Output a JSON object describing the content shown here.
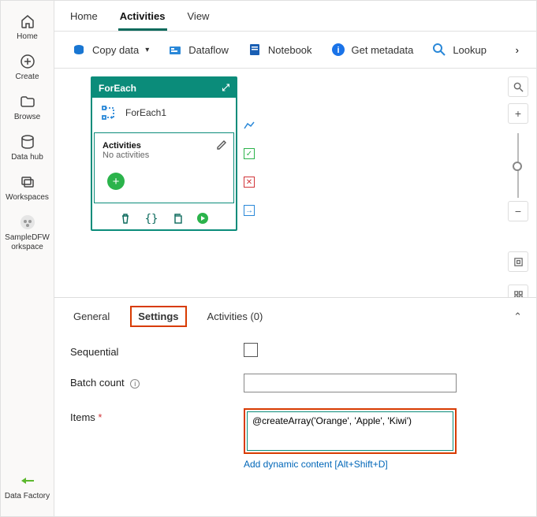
{
  "rail": {
    "items": [
      {
        "label": "Home"
      },
      {
        "label": "Create"
      },
      {
        "label": "Browse"
      },
      {
        "label": "Data hub"
      },
      {
        "label": "Workspaces"
      },
      {
        "label": "SampleDFW orkspace"
      }
    ],
    "bottom": {
      "label": "Data Factory"
    }
  },
  "tabs": [
    {
      "label": "Home"
    },
    {
      "label": "Activities"
    },
    {
      "label": "View"
    }
  ],
  "toolbar": {
    "copy_data": "Copy data",
    "dataflow": "Dataflow",
    "notebook": "Notebook",
    "get_metadata": "Get metadata",
    "lookup": "Lookup"
  },
  "node": {
    "title": "ForEach",
    "name": "ForEach1",
    "section_title": "Activities",
    "section_sub": "No activities"
  },
  "detail": {
    "tabs": {
      "general": "General",
      "settings": "Settings",
      "activities": "Activities (0)"
    },
    "form": {
      "sequential_label": "Sequential",
      "batch_label": "Batch count",
      "items_label": "Items",
      "items_value": "@createArray('Orange', 'Apple', 'Kiwi')",
      "dyn_link": "Add dynamic content [Alt+Shift+D]"
    }
  }
}
